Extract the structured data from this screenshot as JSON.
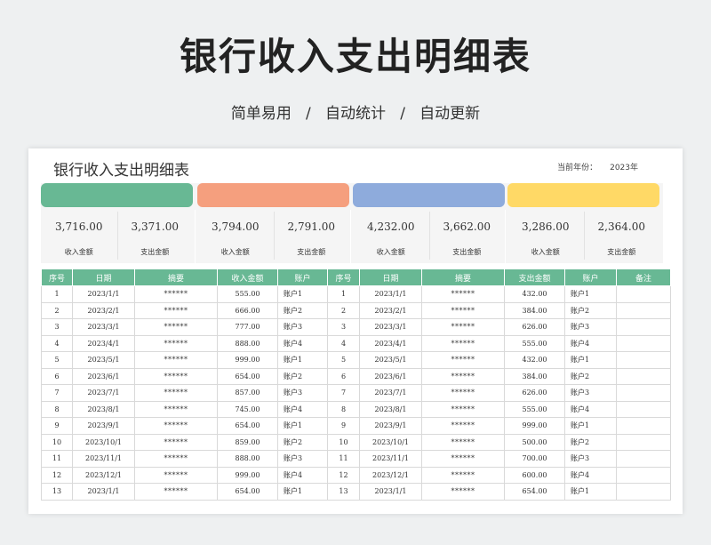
{
  "hero_title": "银行收入支出明细表",
  "subtitle": "简单易用   /   自动统计   /   自动更新",
  "sheet": {
    "title": "银行收入支出明细表",
    "year_label": "当前年份：",
    "year_value": "2023年"
  },
  "cards": [
    {
      "color": "#68b894",
      "income": "3,716.00",
      "expense": "3,371.00",
      "income_label": "收入金额",
      "expense_label": "支出金额"
    },
    {
      "color": "#f59f7e",
      "income": "3,794.00",
      "expense": "2,791.00",
      "income_label": "收入金额",
      "expense_label": "支出金额"
    },
    {
      "color": "#8eabdc",
      "income": "4,232.00",
      "expense": "3,662.00",
      "income_label": "收入金额",
      "expense_label": "支出金额"
    },
    {
      "color": "#ffd966",
      "income": "3,286.00",
      "expense": "2,364.00",
      "income_label": "收入金额",
      "expense_label": "支出金额"
    }
  ],
  "headers": [
    "序号",
    "日期",
    "摘要",
    "收入金额",
    "账户",
    "序号",
    "日期",
    "摘要",
    "支出金额",
    "账户",
    "备注"
  ],
  "rows": [
    [
      "1",
      "2023/1/1",
      "******",
      "555.00",
      "账户1",
      "1",
      "2023/1/1",
      "******",
      "432.00",
      "账户1",
      ""
    ],
    [
      "2",
      "2023/2/1",
      "******",
      "666.00",
      "账户2",
      "2",
      "2023/2/1",
      "******",
      "384.00",
      "账户2",
      ""
    ],
    [
      "3",
      "2023/3/1",
      "******",
      "777.00",
      "账户3",
      "3",
      "2023/3/1",
      "******",
      "626.00",
      "账户3",
      ""
    ],
    [
      "4",
      "2023/4/1",
      "******",
      "888.00",
      "账户4",
      "4",
      "2023/4/1",
      "******",
      "555.00",
      "账户4",
      ""
    ],
    [
      "5",
      "2023/5/1",
      "******",
      "999.00",
      "账户1",
      "5",
      "2023/5/1",
      "******",
      "432.00",
      "账户1",
      ""
    ],
    [
      "6",
      "2023/6/1",
      "******",
      "654.00",
      "账户2",
      "6",
      "2023/6/1",
      "******",
      "384.00",
      "账户2",
      ""
    ],
    [
      "7",
      "2023/7/1",
      "******",
      "857.00",
      "账户3",
      "7",
      "2023/7/1",
      "******",
      "626.00",
      "账户3",
      ""
    ],
    [
      "8",
      "2023/8/1",
      "******",
      "745.00",
      "账户4",
      "8",
      "2023/8/1",
      "******",
      "555.00",
      "账户4",
      ""
    ],
    [
      "9",
      "2023/9/1",
      "******",
      "654.00",
      "账户1",
      "9",
      "2023/9/1",
      "******",
      "999.00",
      "账户1",
      ""
    ],
    [
      "10",
      "2023/10/1",
      "******",
      "859.00",
      "账户2",
      "10",
      "2023/10/1",
      "******",
      "500.00",
      "账户2",
      ""
    ],
    [
      "11",
      "2023/11/1",
      "******",
      "888.00",
      "账户3",
      "11",
      "2023/11/1",
      "******",
      "700.00",
      "账户3",
      ""
    ],
    [
      "12",
      "2023/12/1",
      "******",
      "999.00",
      "账户4",
      "12",
      "2023/12/1",
      "******",
      "600.00",
      "账户4",
      ""
    ],
    [
      "13",
      "2023/1/1",
      "******",
      "654.00",
      "账户1",
      "13",
      "2023/1/1",
      "******",
      "654.00",
      "账户1",
      ""
    ]
  ]
}
